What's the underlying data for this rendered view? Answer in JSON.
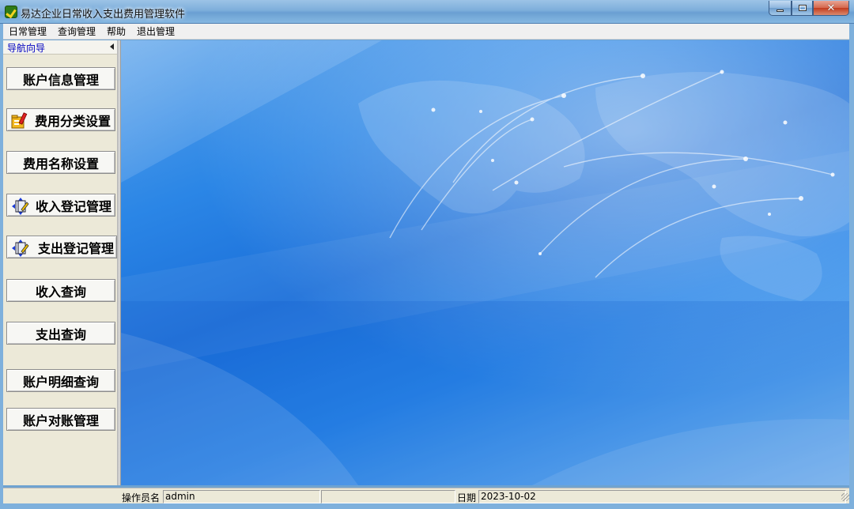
{
  "window": {
    "title": "易达企业日常收入支出费用管理软件",
    "close_glyph": "✕"
  },
  "menu": {
    "items": [
      "日常管理",
      "查询管理",
      "帮助",
      "退出管理"
    ]
  },
  "nav": {
    "header": "导航向导",
    "buttons": [
      {
        "label": "账户信息管理",
        "icon": null
      },
      {
        "label": "费用分类设置",
        "icon": "folder-settings-icon"
      },
      {
        "label": "费用名称设置",
        "icon": null
      },
      {
        "label": "收入登记管理",
        "icon": "book-edit-icon"
      },
      {
        "label": "支出登记管理",
        "icon": "book-edit-icon"
      },
      {
        "label": "收入查询",
        "icon": null
      },
      {
        "label": "支出查询",
        "icon": null
      },
      {
        "label": "账户明细查询",
        "icon": null
      },
      {
        "label": "账户对账管理",
        "icon": null
      }
    ]
  },
  "status": {
    "operator_label": "操作员名",
    "operator_value": "admin",
    "date_label": "日期",
    "date_value": "2023-10-02"
  },
  "colors": {
    "title_bar": "#7daedb",
    "nav_panel": "#ece9d8",
    "nav_header_text": "#0000c0",
    "main_bg": "#2b86e6",
    "close_button": "#c23b1d"
  }
}
